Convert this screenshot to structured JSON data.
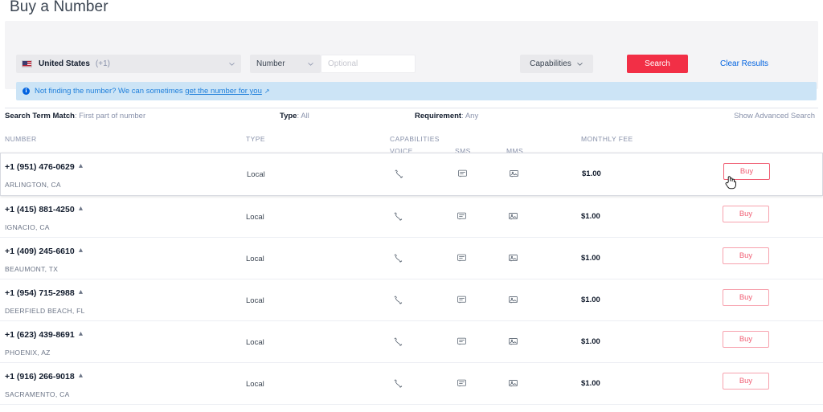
{
  "page": {
    "title": "Buy a Number"
  },
  "search": {
    "country": {
      "name": "United States",
      "code": "(+1)",
      "icon": "us-flag-icon",
      "chevron": "chevron-down-icon"
    },
    "type_filter": {
      "label": "Number",
      "chevron": "chevron-down-icon"
    },
    "term_input": {
      "value": "",
      "placeholder": "Optional"
    },
    "capabilities_filter": {
      "label": "Capabilities",
      "chevron": "chevron-down-icon"
    },
    "search_button": "Search",
    "clear_link": "Clear Results"
  },
  "info_banner": {
    "icon": "info-icon",
    "text_before": "Not finding the number? We can sometimes ",
    "link_text": "get the number for you",
    "external_icon": "external-link-icon"
  },
  "filters": {
    "match_label": "Search Term Match",
    "match_value": "First part of number",
    "type_label": "Type",
    "type_value": "All",
    "requirement_label": "Requirement",
    "requirement_value": "Any",
    "advanced_link": "Show Advanced Search"
  },
  "table": {
    "headers": {
      "number": "NUMBER",
      "type": "TYPE",
      "capabilities": "CAPABILITIES",
      "voice": "VOICE",
      "sms": "SMS",
      "mms": "MMS",
      "monthly_fee": "MONTHLY FEE"
    },
    "buy_label": "Buy",
    "icons": {
      "verified": "beta-badge-icon",
      "voice": "phone-handset-icon",
      "sms": "chat-bubble-icon",
      "mms": "image-icon"
    },
    "rows": [
      {
        "number": "+1 (951) 476-0629",
        "locality": "ARLINGTON, CA",
        "type": "Local",
        "fee": "$1.00",
        "buy": "Buy",
        "hovered": true
      },
      {
        "number": "+1 (415) 881-4250",
        "locality": "IGNACIO, CA",
        "type": "Local",
        "fee": "$1.00",
        "buy": "Buy",
        "hovered": false
      },
      {
        "number": "+1 (409) 245-6610",
        "locality": "BEAUMONT, TX",
        "type": "Local",
        "fee": "$1.00",
        "buy": "Buy",
        "hovered": false
      },
      {
        "number": "+1 (954) 715-2988",
        "locality": "DEERFIELD BEACH, FL",
        "type": "Local",
        "fee": "$1.00",
        "buy": "Buy",
        "hovered": false
      },
      {
        "number": "+1 (623) 439-8691",
        "locality": "PHOENIX, AZ",
        "type": "Local",
        "fee": "$1.00",
        "buy": "Buy",
        "hovered": false
      },
      {
        "number": "+1 (916) 266-9018",
        "locality": "SACRAMENTO, CA",
        "type": "Local",
        "fee": "$1.00",
        "buy": "Buy",
        "hovered": false
      }
    ]
  },
  "cursor": {
    "type": "pointing-hand-cursor"
  },
  "colors": {
    "brand_red": "#F22F46",
    "link_blue": "#0263E0",
    "banner_bg": "#CCE4F6",
    "panel_bg": "#F4F4F6",
    "buy_border": "#F7A2AE"
  }
}
